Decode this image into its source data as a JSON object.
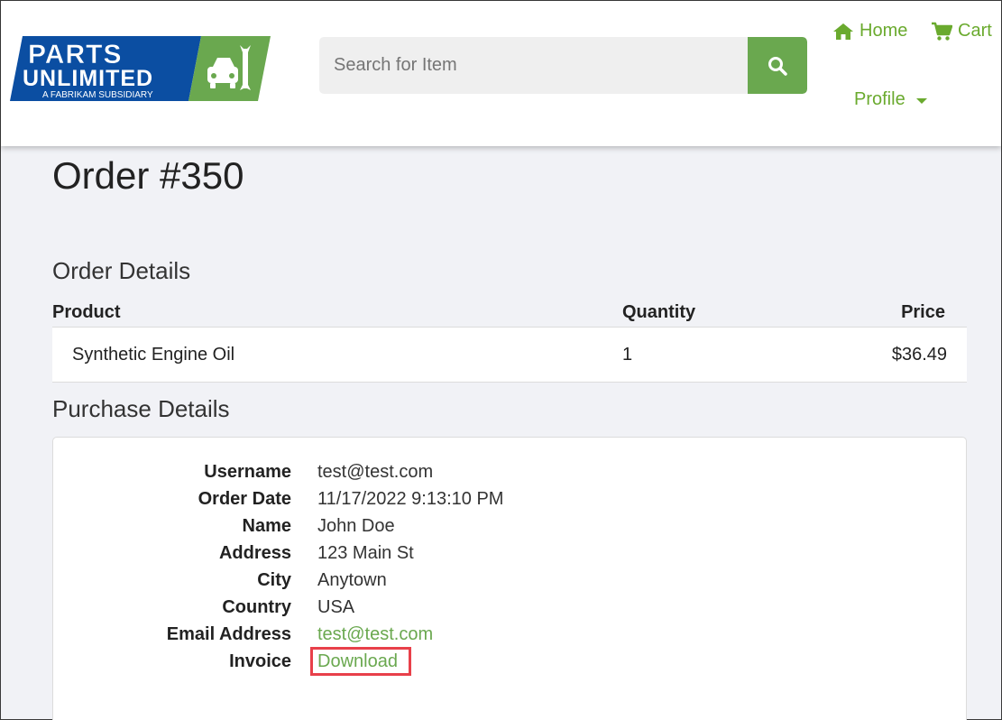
{
  "header": {
    "logo": {
      "line1": "PARTS",
      "line2": "UNLIMITED",
      "tagline": "A FABRIKAM SUBSIDIARY",
      "blue": "#0b4ea2",
      "green": "#6aa84f"
    },
    "search": {
      "placeholder": "Search for Item",
      "value": ""
    },
    "nav": {
      "home": "Home",
      "cart": "Cart",
      "profile": "Profile"
    }
  },
  "main": {
    "title": "Order #350",
    "order_details": {
      "heading": "Order Details",
      "columns": [
        "Product",
        "Quantity",
        "Price"
      ],
      "rows": [
        {
          "product": "Synthetic Engine Oil",
          "quantity": "1",
          "price": "$36.49"
        }
      ]
    },
    "purchase_details": {
      "heading": "Purchase Details",
      "fields": [
        {
          "label": "Username",
          "value": "test@test.com"
        },
        {
          "label": "Order Date",
          "value": "11/17/2022 9:13:10 PM"
        },
        {
          "label": "Name",
          "value": "John Doe"
        },
        {
          "label": "Address",
          "value": "123 Main St"
        },
        {
          "label": "City",
          "value": "Anytown"
        },
        {
          "label": "Country",
          "value": "USA"
        },
        {
          "label": "Email Address",
          "value": "test@test.com"
        },
        {
          "label": "Invoice",
          "value": "Download"
        }
      ]
    }
  },
  "colors": {
    "accent": "#6aa84f",
    "highlight": "#e8404a"
  }
}
